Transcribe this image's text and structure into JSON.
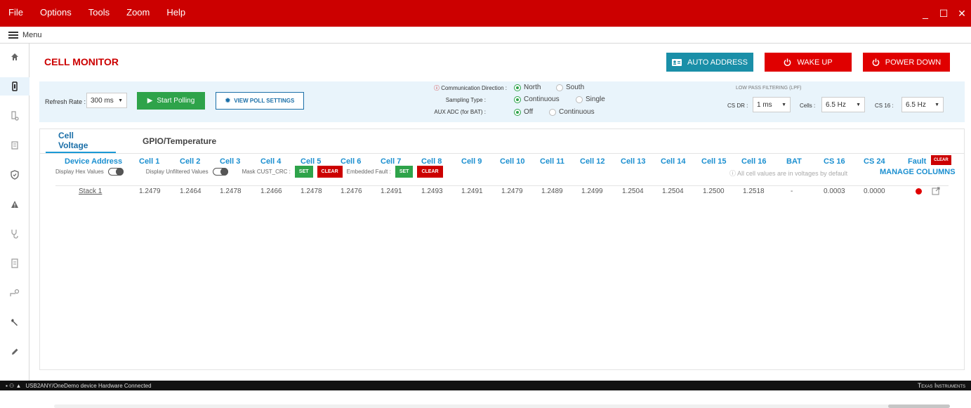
{
  "menubar": {
    "items": [
      "File",
      "Options",
      "Tools",
      "Zoom",
      "Help"
    ],
    "minimize": "_",
    "maximize": "☐",
    "close": "✕"
  },
  "submenu": {
    "label": "Menu"
  },
  "header": {
    "title": "CELL MONITOR",
    "auto_address": "AUTO ADDRESS",
    "wake_up": "WAKE UP",
    "power_down": "POWER DOWN"
  },
  "controls": {
    "refresh_label": "Refresh Rate :",
    "refresh_value": "300 ms",
    "start_polling": "Start Polling",
    "view_poll_settings": "VIEW POLL SETTINGS",
    "comm_dir_label": "Communication Direction :",
    "comm_north": "North",
    "comm_south": "South",
    "sampling_label": "Sampling Type :",
    "sampling_continuous": "Continuous",
    "sampling_single": "Single",
    "aux_label": "AUX ADC (for BAT) :",
    "aux_off": "Off",
    "aux_continuous": "Continuous",
    "lpf_title": "LOW PASS FILTERING (LPF)",
    "cs_dr_label": "CS DR :",
    "cs_dr_value": "1 ms",
    "cells_label": "Cells :",
    "cells_value": "6.5 Hz",
    "cs16_label": "CS 16 :",
    "cs16_value": "6.5 Hz"
  },
  "tabs": [
    {
      "label": "Cell Voltage"
    },
    {
      "label": "GPIO/Temperature"
    }
  ],
  "options": {
    "hex_values": "Display Hex Values",
    "unfiltered": "Display Unfiltered Values",
    "mask_crc": "Mask CUST_CRC :",
    "set": "SET",
    "clear": "CLEAR",
    "embedded_fault": "Embedded Fault :",
    "info_text": "All cell values are in voltages by default",
    "manage_columns": "MANAGE COLUMNS"
  },
  "table": {
    "headers": [
      "Device Address",
      "Cell 1",
      "Cell 2",
      "Cell 3",
      "Cell 4",
      "Cell 5",
      "Cell 6",
      "Cell 7",
      "Cell 8",
      "Cell 9",
      "Cell 10",
      "Cell 11",
      "Cell 12",
      "Cell 13",
      "Cell 14",
      "Cell 15",
      "Cell 16",
      "BAT",
      "CS 16",
      "CS 24",
      "Fault"
    ],
    "fault_clear": "CLEAR",
    "rows": [
      [
        "Stack 1",
        "1.2479",
        "1.2464",
        "1.2478",
        "1.2466",
        "1.2478",
        "1.2476",
        "1.2491",
        "1.2493",
        "1.2491",
        "1.2479",
        "1.2489",
        "1.2499",
        "1.2504",
        "1.2504",
        "1.2500",
        "1.2518",
        "-",
        "0.0003",
        "0.0000"
      ]
    ]
  },
  "status": {
    "text": "USB2ANY/OneDemo device    Hardware Connected",
    "brand": "Texas Instruments"
  },
  "colors": {
    "brand_red": "#cc0000",
    "accent_blue": "#1b8fd0",
    "green": "#2ea34a",
    "teal": "#1a8fa8"
  }
}
